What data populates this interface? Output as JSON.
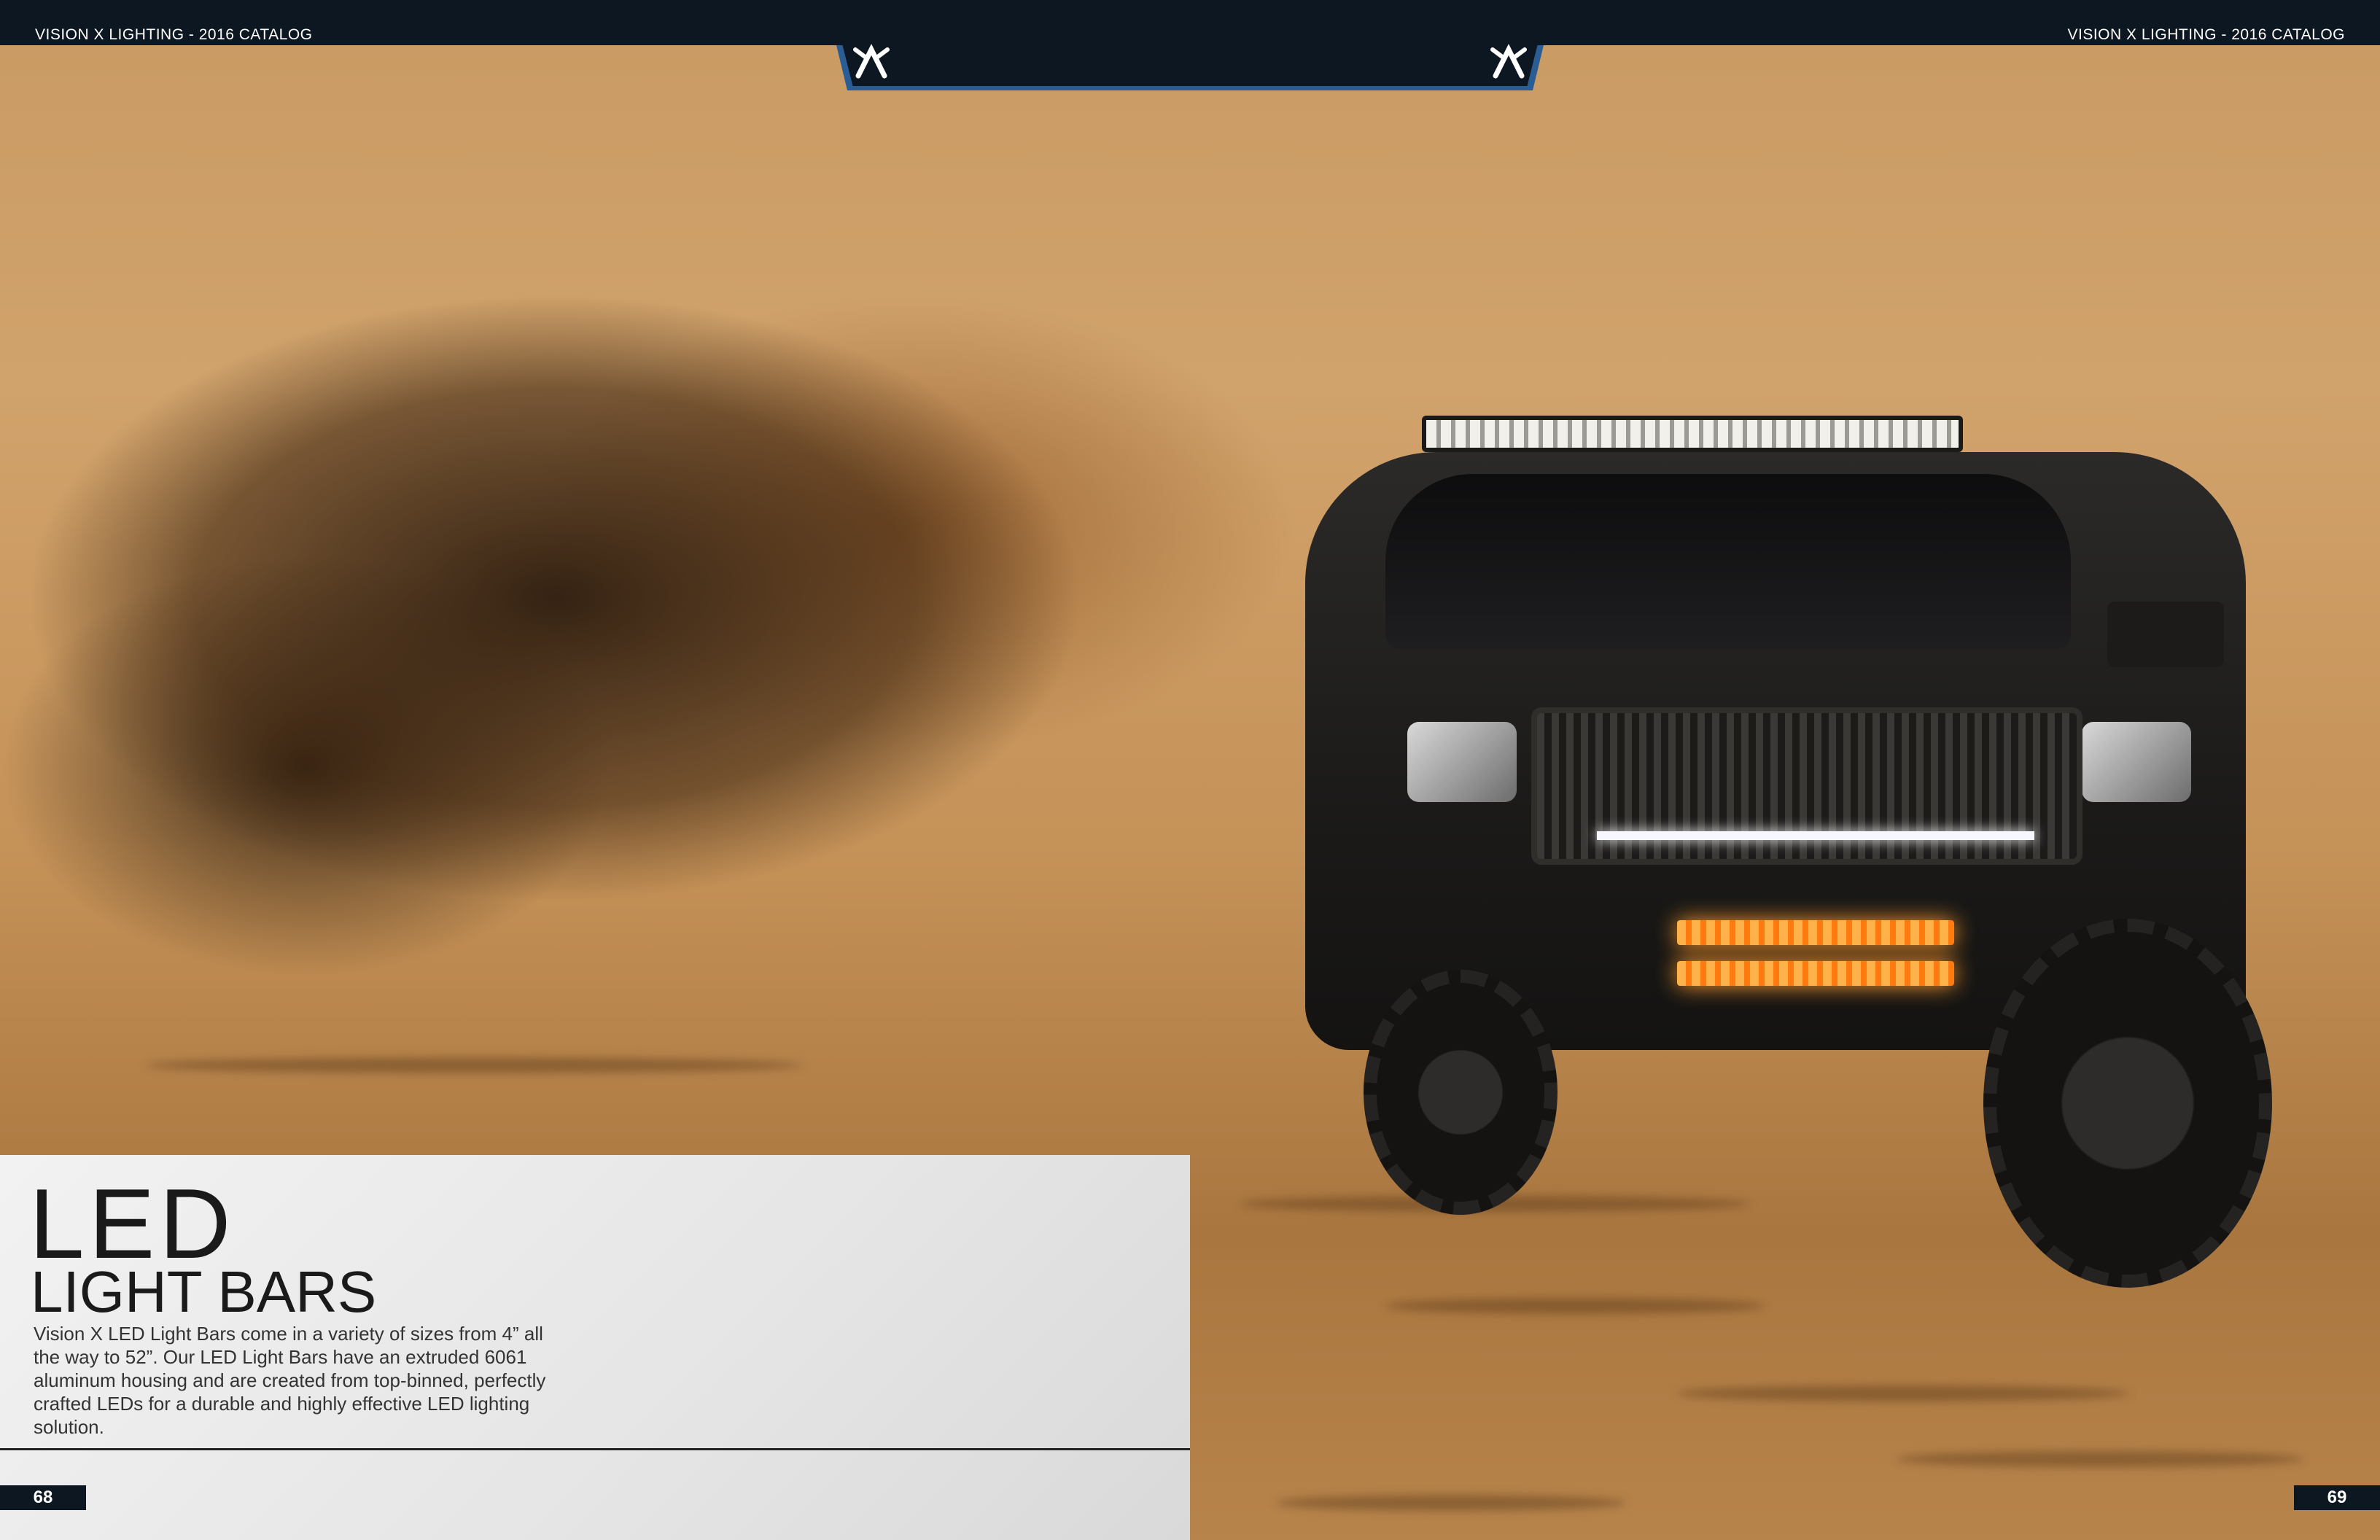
{
  "header": {
    "left_title": "VISION X LIGHTING - 2016 CATALOG",
    "right_title": "VISION X LIGHTING - 2016 CATALOG"
  },
  "logo_icon": "vision-x-logo",
  "hero": {
    "title": "LED",
    "subtitle": "LIGHT BARS",
    "description": "Vision X LED Light Bars come in a variety of sizes from 4” all the way to 52”. Our LED Light Bars have an extruded 6061 aluminum housing and are created from top-binned, perfectly crafted LEDs for a durable and highly effective LED lighting solution."
  },
  "pages": {
    "left": "68",
    "right": "69"
  },
  "colors": {
    "header_bg": "#0c1722",
    "header_accent": "#2b5d95",
    "panel_bg": "#e6e6e6"
  }
}
